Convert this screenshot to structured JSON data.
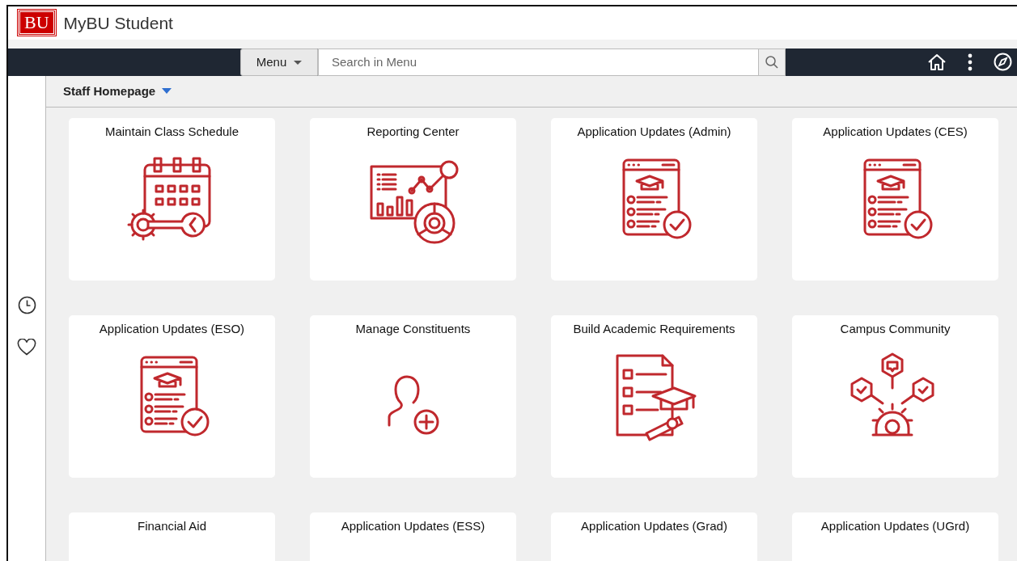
{
  "header": {
    "logo": "BU",
    "title": "MyBU Student"
  },
  "navbar": {
    "menu_button": "Menu",
    "search": {
      "placeholder": "Search in Menu"
    }
  },
  "homepage_selector": {
    "label": "Staff Homepage"
  },
  "tiles": [
    {
      "title": "Maintain Class Schedule",
      "kind": "schedule"
    },
    {
      "title": "Reporting Center",
      "kind": "report"
    },
    {
      "title": "Application Updates (Admin)",
      "kind": "application"
    },
    {
      "title": "Application Updates (CES)",
      "kind": "application"
    },
    {
      "title": "Application Updates (ESO)",
      "kind": "application"
    },
    {
      "title": "Manage Constituents",
      "kind": "constituent"
    },
    {
      "title": "Build Academic Requirements",
      "kind": "requirements"
    },
    {
      "title": "Campus Community",
      "kind": "community"
    },
    {
      "title": "Financial Aid"
    },
    {
      "title": "Application Updates (ESS)"
    },
    {
      "title": "Application Updates (Grad)"
    },
    {
      "title": "Application Updates (UGrd)"
    }
  ]
}
